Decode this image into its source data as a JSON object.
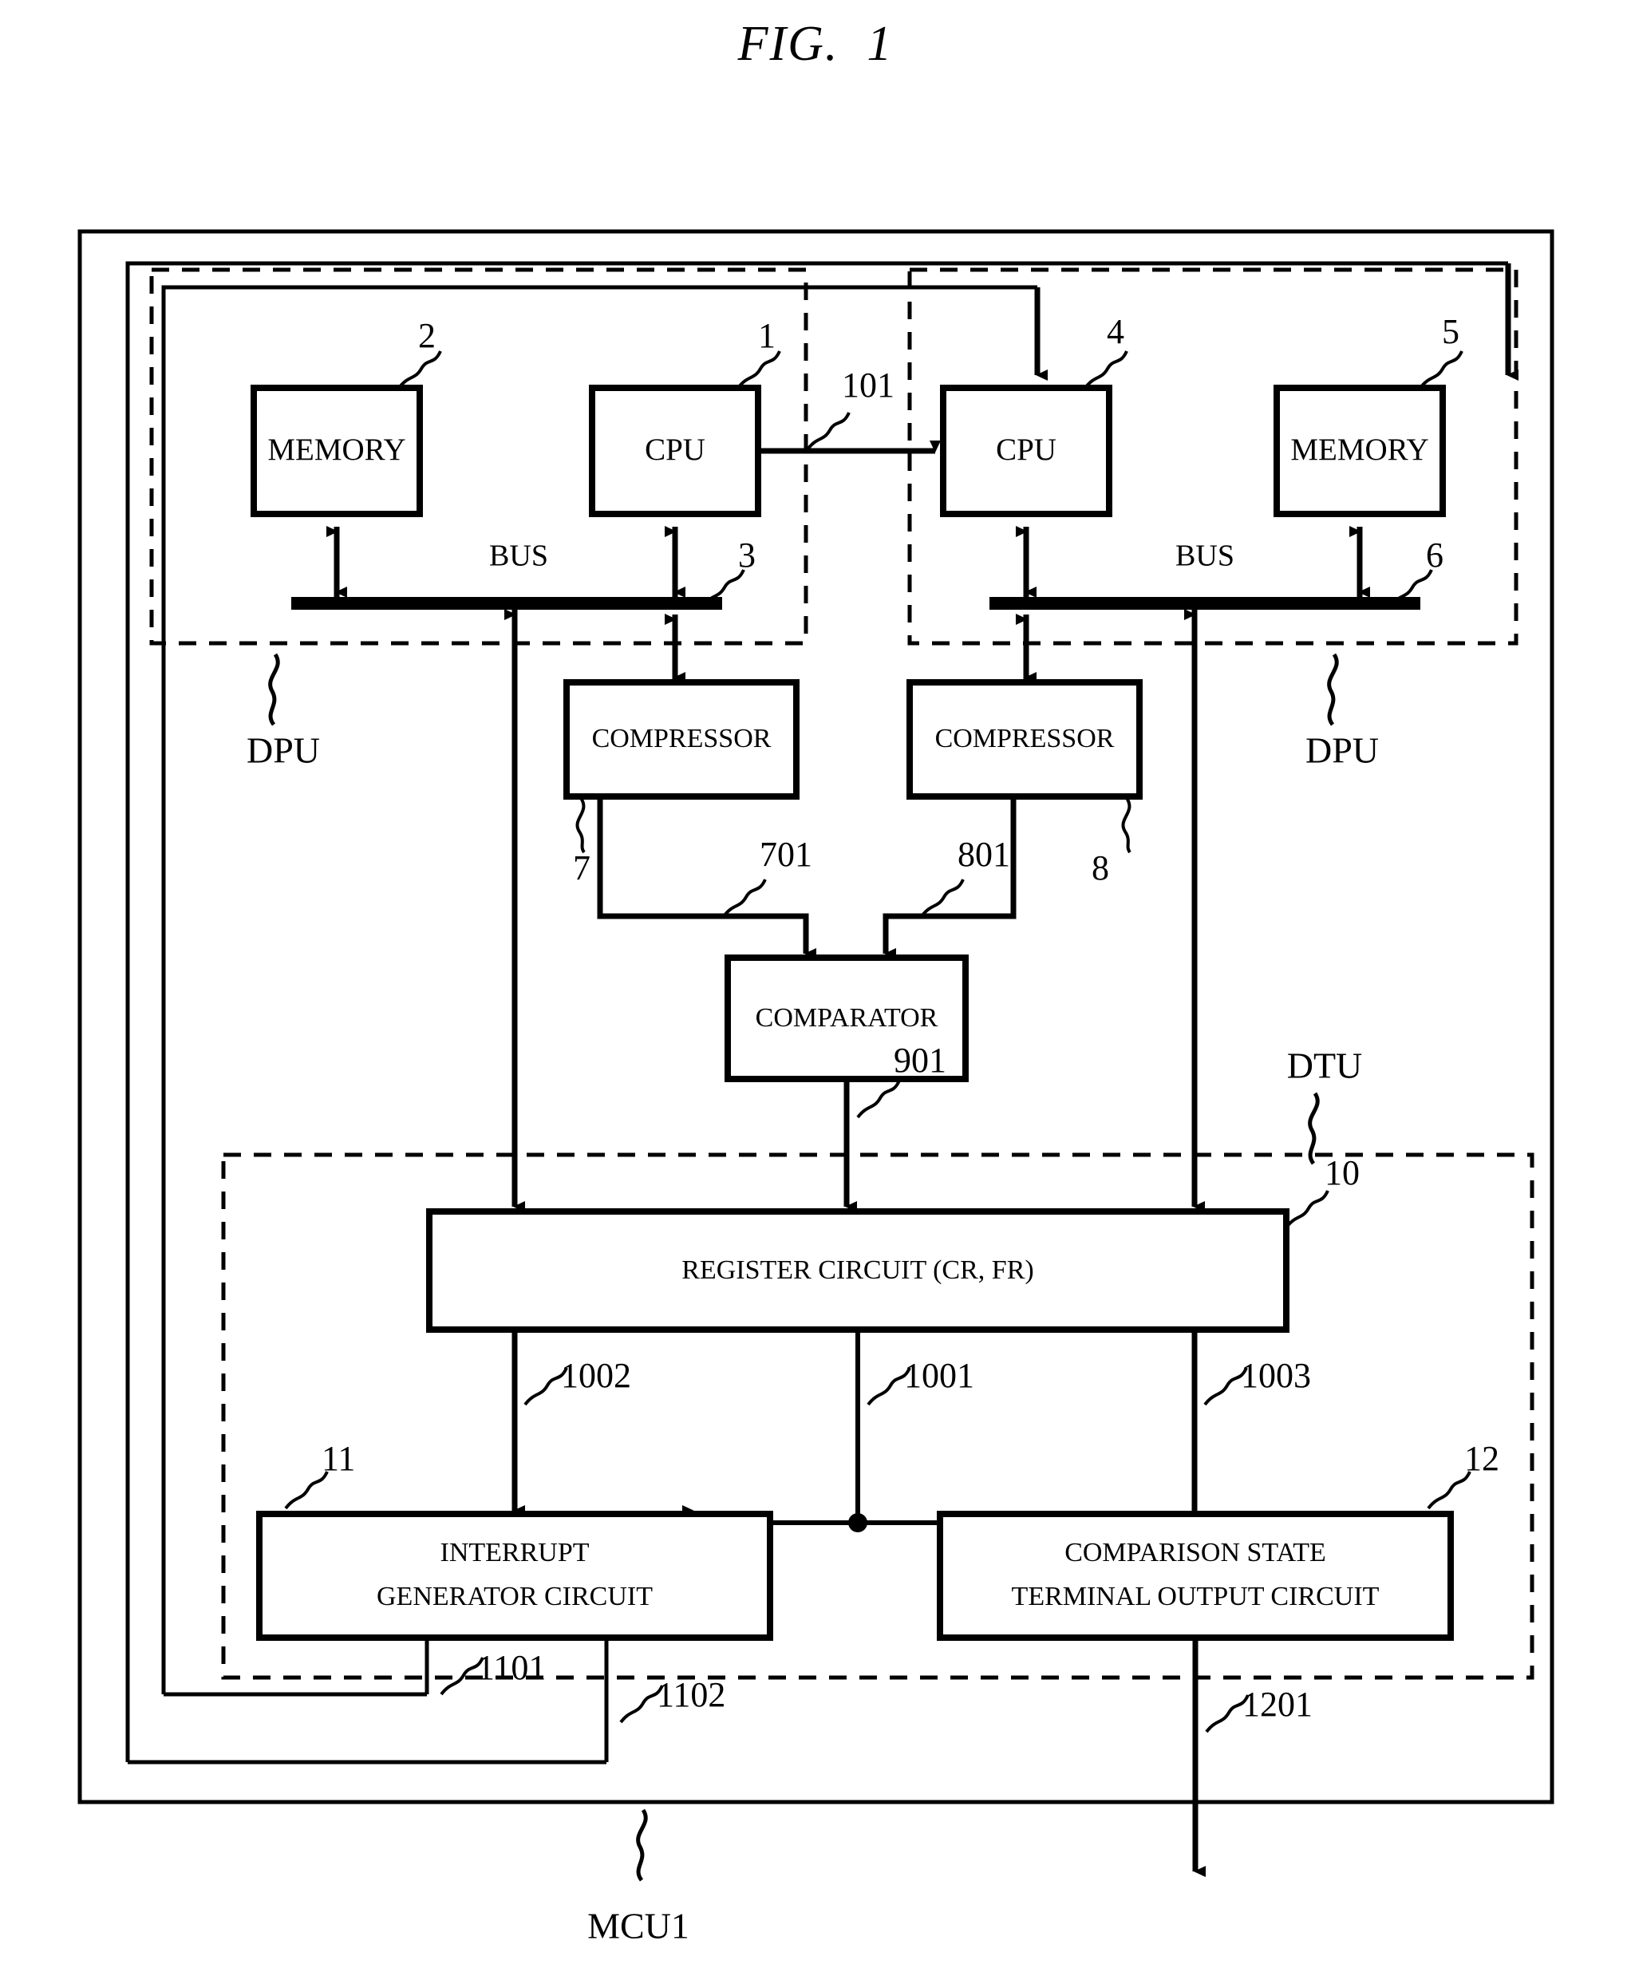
{
  "figure": {
    "title": "FIG.  1"
  },
  "blocks": {
    "memory_left": "MEMORY",
    "cpu_left": "CPU",
    "cpu_right": "CPU",
    "memory_right": "MEMORY",
    "compressor_left": "COMPRESSOR",
    "compressor_right": "COMPRESSOR",
    "comparator": "COMPARATOR",
    "register_circuit": "REGISTER CIRCUIT (CR, FR)",
    "interrupt_generator_line1": "INTERRUPT",
    "interrupt_generator_line2": "GENERATOR CIRCUIT",
    "comparison_state_line1": "COMPARISON STATE",
    "comparison_state_line2": "TERMINAL OUTPUT CIRCUIT"
  },
  "bus_labels": {
    "left": "BUS",
    "right": "BUS"
  },
  "unit_labels": {
    "dpu_left": "DPU",
    "dpu_right": "DPU",
    "dtu": "DTU",
    "mcu": "MCU1"
  },
  "reference_numerals": {
    "memory_left": "2",
    "cpu_left": "1",
    "cpu_right": "4",
    "memory_right": "5",
    "bus_left": "3",
    "bus_right": "6",
    "compressor_left": "7",
    "compressor_right": "8",
    "interrupt_generator": "11",
    "comparison_state": "12",
    "register_circuit": "10",
    "signal_101": "101",
    "signal_701": "701",
    "signal_801": "801",
    "signal_901": "901",
    "signal_1001": "1001",
    "signal_1002": "1002",
    "signal_1003": "1003",
    "signal_1101": "1101",
    "signal_1102": "1102",
    "signal_1201": "1201"
  },
  "colors": {
    "ink": "#000000",
    "paper": "#ffffff"
  }
}
